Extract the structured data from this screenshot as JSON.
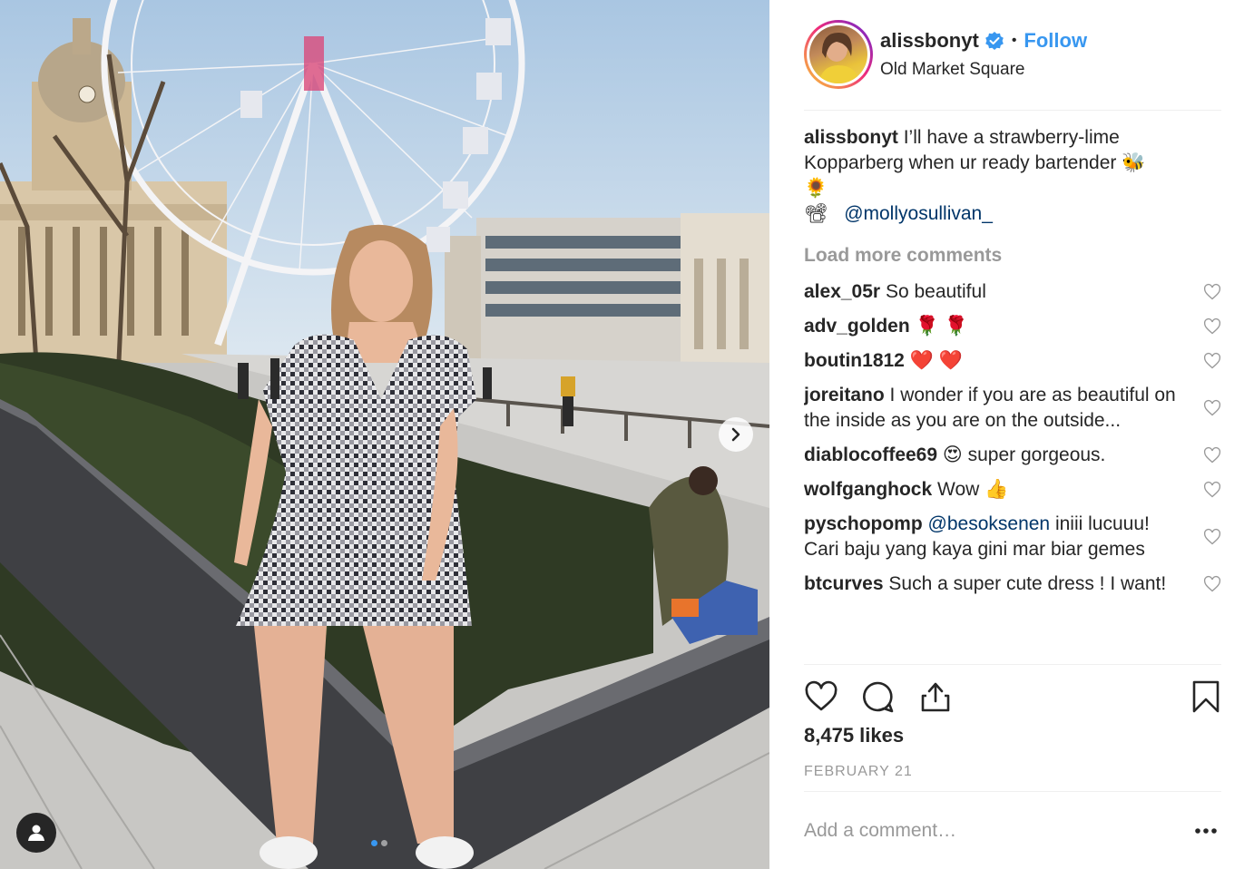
{
  "post": {
    "username": "alissbonyt",
    "separator": "•",
    "follow_label": "Follow",
    "location": "Old Market Square",
    "caption": {
      "username": "alissbonyt",
      "text": "I’ll have a strawberry-lime Kopparberg when ur ready bartender 🐝\n🌻",
      "line2_emoji": "📽",
      "mention": "@mollyosullivan_"
    },
    "load_more": "Load more comments",
    "comments": [
      {
        "username": "alex_05r",
        "text": "So beautiful"
      },
      {
        "username": "adv_golden",
        "text": "🌹 🌹"
      },
      {
        "username": "boutin1812",
        "text": "❤️ ❤️"
      },
      {
        "username": "joreitano",
        "text": "I wonder if you are as beautiful on the inside as you are on the outside..."
      },
      {
        "username": "diablocoffee69",
        "text": "😍  super gorgeous."
      },
      {
        "username": "wolfganghock",
        "text": "Wow 👍"
      },
      {
        "username": "pyschopomp",
        "mention": "@besoksenen",
        "text": "iniii lucuuu! Cari baju yang kaya gini mar biar gemes"
      },
      {
        "username": "btcurves",
        "text": "Such a super cute dress ! I want!"
      }
    ],
    "likes": "8,475 likes",
    "date": "FEBRUARY 21",
    "add_comment_placeholder": "Add a comment…"
  },
  "carousel": {
    "slide_count": 2,
    "active_index": 0
  },
  "icons": {
    "verified": "verified-badge-icon",
    "like": "heart-icon",
    "comment": "comment-bubble-icon",
    "share": "share-icon",
    "save": "bookmark-icon",
    "more": "ellipsis-icon",
    "next": "chevron-right-icon",
    "tag": "user-tag-icon"
  },
  "colors": {
    "link_blue": "#3897f0",
    "mention_blue": "#003569",
    "muted": "#999999",
    "text": "#262626"
  }
}
